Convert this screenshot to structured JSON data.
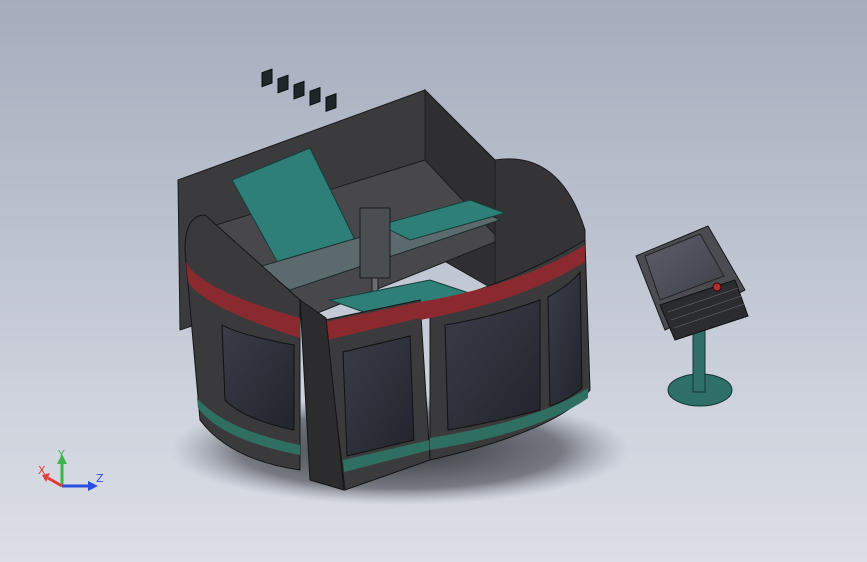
{
  "viewport": {
    "background_top": "#a5adbd",
    "background_bottom": "#dcdfe6"
  },
  "model": {
    "enclosure_color": "#3a3a3c",
    "stripe_red": "#8a2a2e",
    "stripe_green": "#2f6f62",
    "gantry_teal": "#2e7f77",
    "window_color": "#2d2f38"
  },
  "triad": {
    "x_label": "X",
    "y_label": "Y",
    "z_label": "Z",
    "x_color": "#e23b3b",
    "y_color": "#3bb84a",
    "z_color": "#2a4fe0"
  }
}
